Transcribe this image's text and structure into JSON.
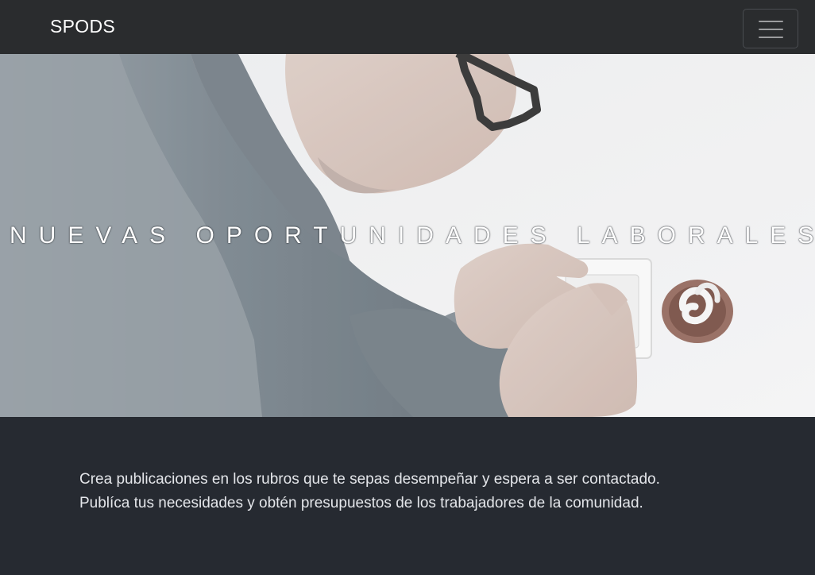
{
  "navbar": {
    "brand": "SPODS",
    "toggler_icon": "hamburger-menu-icon"
  },
  "hero": {
    "title": "NUEVAS OPORTUNIDADES LABORALES",
    "image": "electrician-installing-wall-socket-photo"
  },
  "content": {
    "line1": "Crea publicaciones en los rubros que te sepas desempeñar y espera a ser contactado.",
    "line2": "Publíca tus necesidades y obtén presupuestos de los trabajadores de la comunidad."
  },
  "colors": {
    "navbar_bg": "#2a2c2e",
    "page_bg": "#262a31",
    "text_light": "#e4e6ea"
  }
}
